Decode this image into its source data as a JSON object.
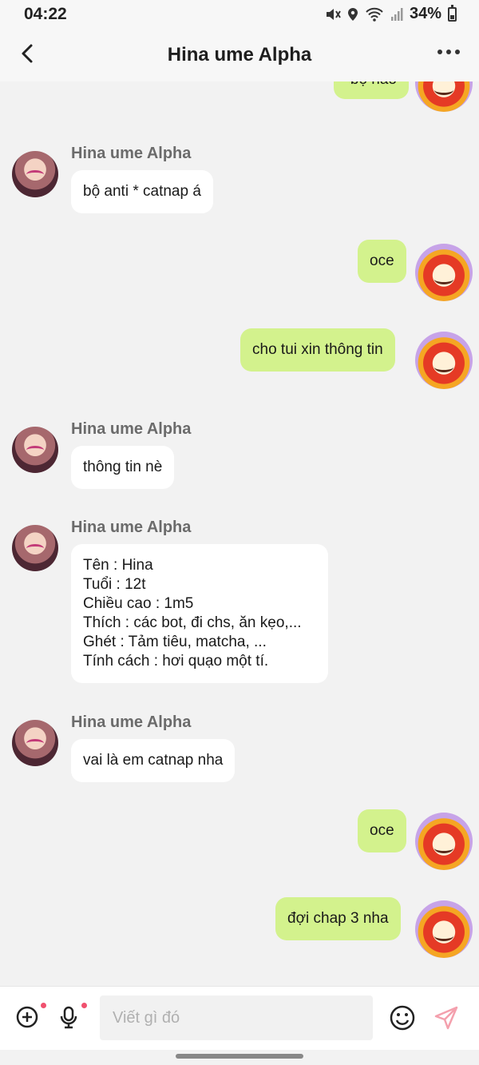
{
  "status": {
    "time": "04:22",
    "battery": "34%"
  },
  "header": {
    "title": "Hina ume Alpha"
  },
  "chat": {
    "partial_top": "bộ nào",
    "messages": [
      {
        "side": "in",
        "sender": "Hina ume Alpha",
        "text": "bộ anti * catnap á"
      },
      {
        "side": "out",
        "text": "oce"
      },
      {
        "side": "out",
        "text": "cho tui xin thông tin"
      },
      {
        "side": "in",
        "sender": "Hina ume Alpha",
        "text": "thông tin nè"
      },
      {
        "side": "in",
        "sender": "Hina ume Alpha",
        "lines": [
          "Tên : Hina",
          "Tuổi : 12t",
          "Chiều cao : 1m5",
          "Thích : các bot, đi chs, ăn kẹo,...",
          "Ghét : Tảm tiêu, matcha, ...",
          "Tính cách : hơi quạo một tí."
        ]
      },
      {
        "side": "in",
        "sender": "Hina ume Alpha",
        "text": "vai là em catnap nha"
      },
      {
        "side": "out",
        "text": "oce"
      },
      {
        "side": "out",
        "text": "đợi chap 3 nha"
      }
    ]
  },
  "input": {
    "placeholder": "Viết gì đó"
  },
  "colors": {
    "outgoing_bubble": "#d3f28d",
    "incoming_bubble": "#ffffff",
    "background": "#f2f2f2",
    "send_icon": "#f4a0ad"
  },
  "icons": [
    "back-arrow-icon",
    "more-dots-icon",
    "add-circle-icon",
    "microphone-icon",
    "emoji-icon",
    "send-icon",
    "mute-icon",
    "location-icon",
    "wifi-icon",
    "signal-icon",
    "battery-icon"
  ]
}
